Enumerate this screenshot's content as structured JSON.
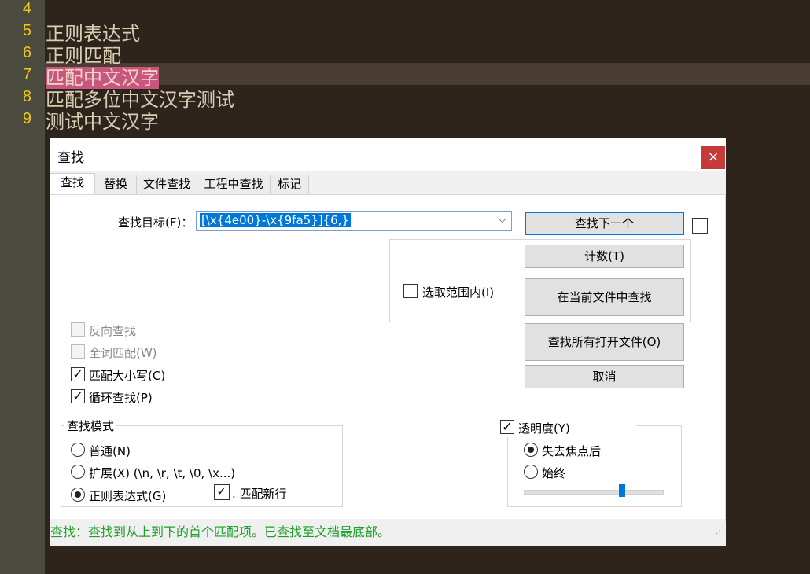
{
  "editor": {
    "line_numbers": [
      "4",
      "5",
      "6",
      "7",
      "8",
      "9"
    ],
    "lines": [
      "",
      "正则表达式",
      "正则匹配",
      "匹配中文汉字",
      "匹配多位中文汉字测试",
      "测试中文汉字"
    ]
  },
  "dialog": {
    "title": "查找",
    "close": "×",
    "tabs": [
      "查找",
      "替换",
      "文件查找",
      "工程中查找",
      "标记"
    ],
    "find_label": "查找目标(F)：",
    "find_value": "[\\x{4e00}-\\x{9fa5}]{6,}",
    "chevron": "⌵",
    "buttons": {
      "find_next": "查找下一个",
      "count": "计数(T)",
      "find_in_current": "在当前文件中查找",
      "find_all_open": "查找所有打开文件(O)",
      "cancel": "取消"
    },
    "in_selection": "选取范围内(I)",
    "options": {
      "backward": "反向查找",
      "whole_word": "全词匹配(W)",
      "match_case": "匹配大小写(C)",
      "wrap": "循环查找(P)"
    },
    "mode": {
      "title": "查找模式",
      "normal": "普通(N)",
      "extended": "扩展(X) (\\n, \\r, \\t, \\0, \\x...)",
      "regex": "正则表达式(G)",
      "dot_newline": ". 匹配新行"
    },
    "transparency": {
      "title": "透明度(Y)",
      "on_lose_focus": "失去焦点后",
      "always": "始终",
      "level_fraction": 0.7
    },
    "status": "查找：查找到从上到下的首个匹配项。已查找至文档最底部。"
  },
  "colors": {
    "selection": "#c9567e",
    "accent": "#0078d7",
    "status_green": "#1fa02a",
    "line_number": "#f0c419"
  }
}
